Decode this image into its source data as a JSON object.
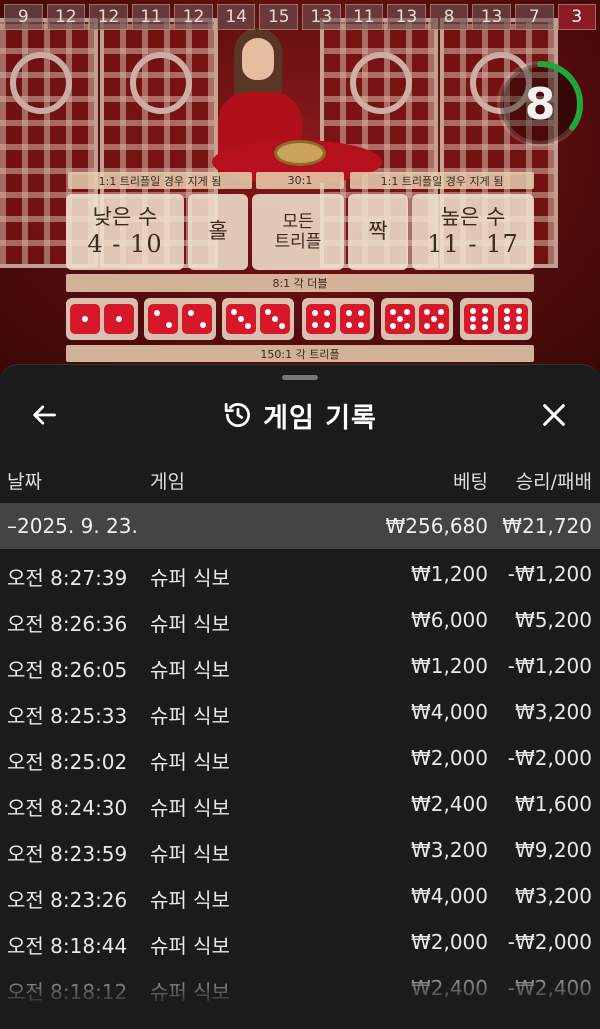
{
  "game": {
    "round_history": [
      "9",
      "12",
      "12",
      "11",
      "12",
      "14",
      "15",
      "13",
      "11",
      "13",
      "8",
      "13",
      "7",
      "3"
    ],
    "timer": "8",
    "timer_progress": 0.35,
    "dealer": "dealer",
    "payout_top_left": "1:1 트리플일 경우 지게 됨",
    "payout_top_mid": "30:1",
    "payout_top_right": "1:1 트리플일 경우 지게 됨",
    "bets": {
      "small_label": "낮은 수",
      "small_range": "4 - 10",
      "odd_label": "홀",
      "any_triple_label_1": "모든",
      "any_triple_label_2": "트리플",
      "even_label": "짝",
      "big_label": "높은 수",
      "big_range": "11 - 17"
    },
    "double_payout": "8:1 각 더블",
    "triple_payout": "150:1 각 트리플",
    "accent": "#d7182a"
  },
  "history": {
    "title": "게임 기록",
    "columns": {
      "date": "날짜",
      "game": "게임",
      "bet": "베팅",
      "winloss": "승리/패배"
    },
    "date_group": {
      "date": "–2025. 9. 23.",
      "bet_total": "₩256,680",
      "win_total": "₩21,720"
    },
    "rows": [
      {
        "time": "오전 8:27:39",
        "game": "슈퍼 식보",
        "bet": "₩1,200",
        "result": "-₩1,200"
      },
      {
        "time": "오전 8:26:36",
        "game": "슈퍼 식보",
        "bet": "₩6,000",
        "result": "₩5,200"
      },
      {
        "time": "오전 8:26:05",
        "game": "슈퍼 식보",
        "bet": "₩1,200",
        "result": "-₩1,200"
      },
      {
        "time": "오전 8:25:33",
        "game": "슈퍼 식보",
        "bet": "₩4,000",
        "result": "₩3,200"
      },
      {
        "time": "오전 8:25:02",
        "game": "슈퍼 식보",
        "bet": "₩2,000",
        "result": "-₩2,000"
      },
      {
        "time": "오전 8:24:30",
        "game": "슈퍼 식보",
        "bet": "₩2,400",
        "result": "₩1,600"
      },
      {
        "time": "오전 8:23:59",
        "game": "슈퍼 식보",
        "bet": "₩3,200",
        "result": "₩9,200"
      },
      {
        "time": "오전 8:23:26",
        "game": "슈퍼 식보",
        "bet": "₩4,000",
        "result": "₩3,200"
      },
      {
        "time": "오전 8:18:44",
        "game": "슈퍼 식보",
        "bet": "₩2,000",
        "result": "-₩2,000"
      },
      {
        "time": "오전 8:18:12",
        "game": "슈퍼 식보",
        "bet": "₩2,400",
        "result": "-₩2,400"
      }
    ]
  },
  "icons": {
    "back": "arrow-left-icon",
    "history": "history-clock-icon",
    "close": "close-icon"
  }
}
